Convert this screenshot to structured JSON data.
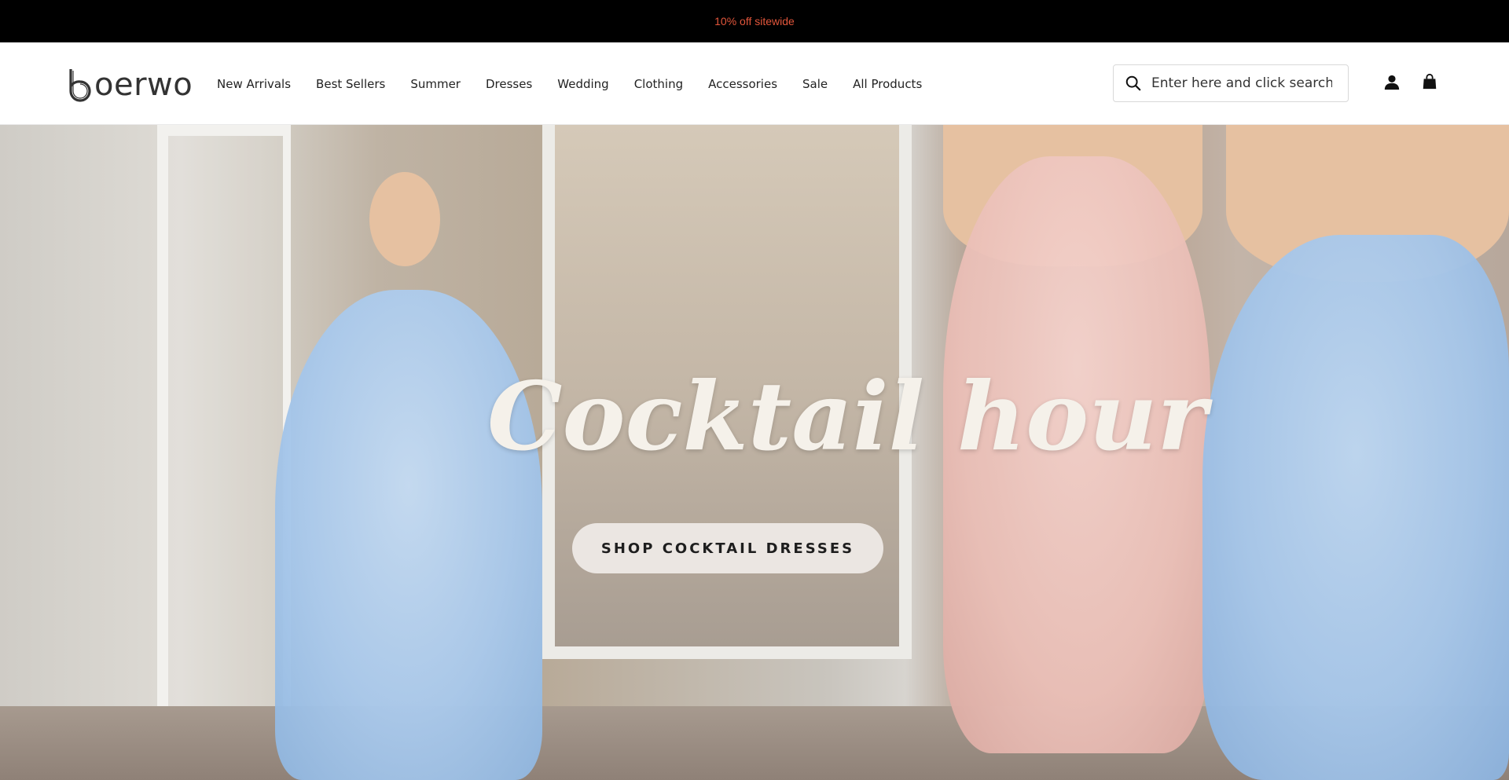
{
  "announcement": {
    "text": "10% off sitewide"
  },
  "logo": {
    "text": "oerwo"
  },
  "nav": {
    "items": [
      {
        "label": "New Arrivals"
      },
      {
        "label": "Best Sellers"
      },
      {
        "label": "Summer"
      },
      {
        "label": "Dresses"
      },
      {
        "label": "Wedding"
      },
      {
        "label": "Clothing"
      },
      {
        "label": "Accessories"
      },
      {
        "label": "Sale"
      },
      {
        "label": "All Products"
      }
    ]
  },
  "search": {
    "placeholder": "Enter here and click search",
    "icon": "search-icon"
  },
  "header_icons": {
    "account": "account-icon",
    "cart": "cart-icon"
  },
  "hero": {
    "title": "Cocktail hour",
    "cta_label": "SHOP COCKTAIL DRESSES"
  },
  "colors": {
    "announcement_bg": "#000000",
    "announcement_text": "#e2563b",
    "header_bg": "#ffffff",
    "cta_bg": "#f0ece8"
  }
}
